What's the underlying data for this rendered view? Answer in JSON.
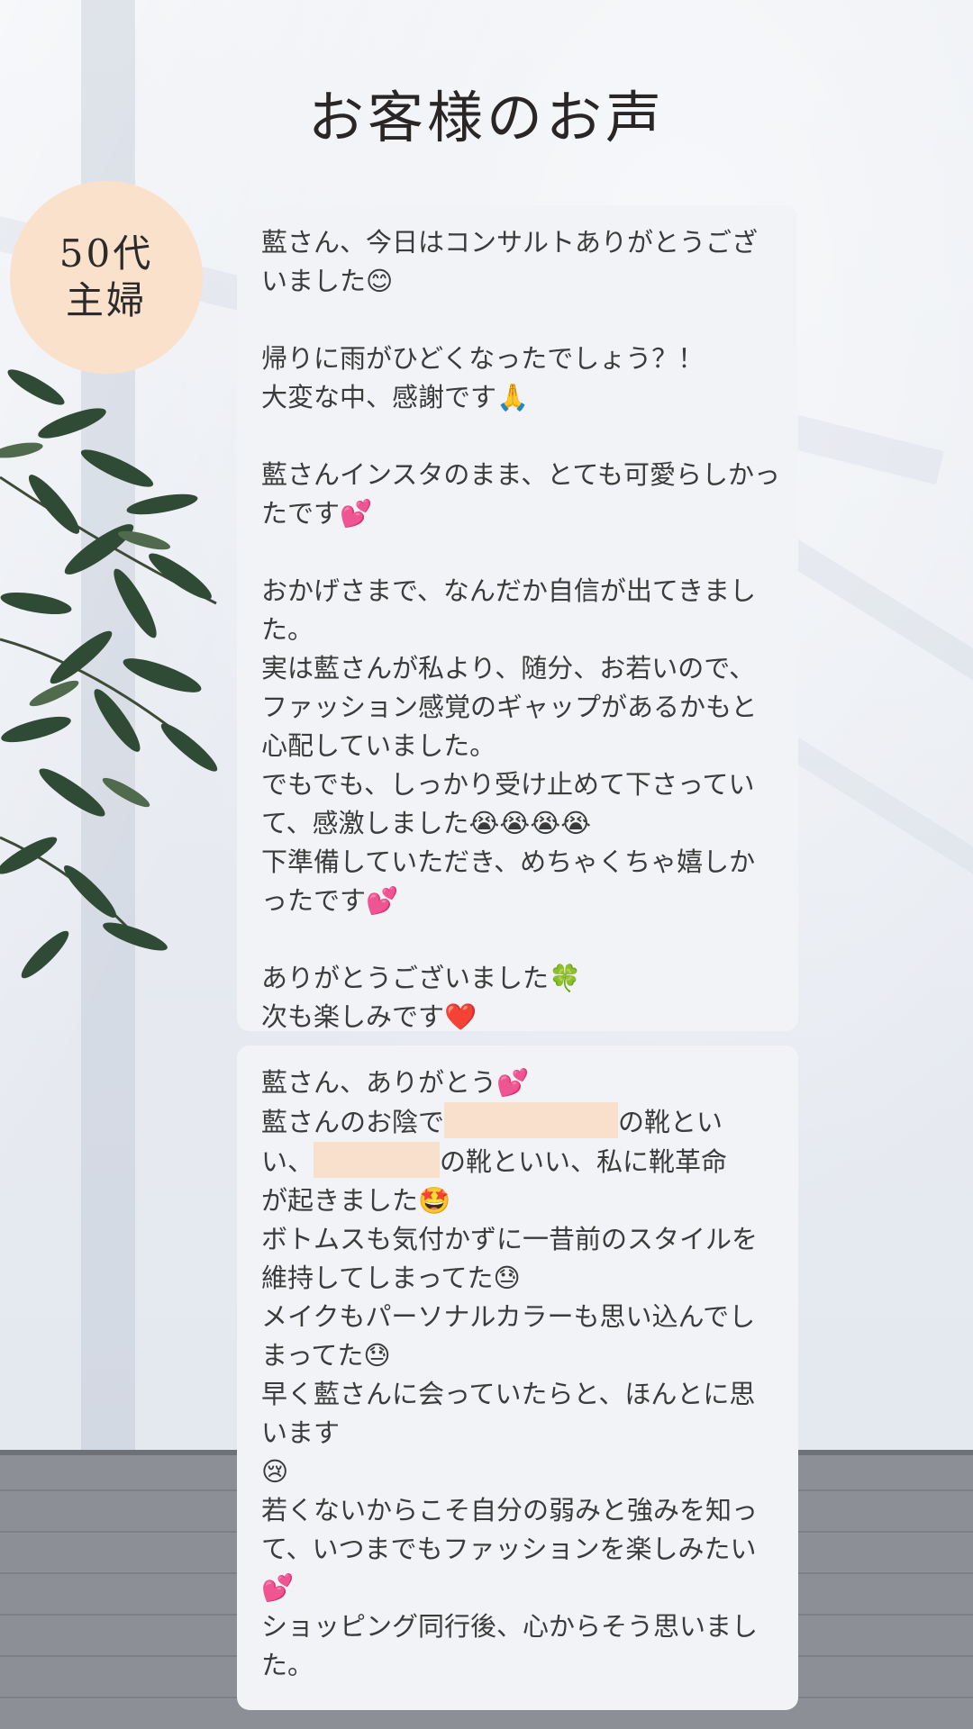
{
  "title": "お客様のお声",
  "badge": {
    "line1": "50代",
    "line2": "主婦"
  },
  "card1": {
    "p1": "藍さん、今日はコンサルトありがとうございました😊",
    "p2a": "帰りに雨がひどくなったでしょう？！",
    "p2b": "大変な中、感謝です🙏",
    "p3": "藍さんインスタのまま、とても可愛らしかったです💕",
    "p4a": "おかげさまで、なんだか自信が出てきました。",
    "p4b": "実は藍さんが私より、随分、お若いので、ファッション感覚のギャップがあるかもと心配していました。",
    "p4c": "でもでも、しっかり受け止めて下さっていて、感激しました😭😭😭😭",
    "p4d": "下準備していただき、めちゃくちゃ嬉しかったです💕",
    "p5a": "ありがとうございました🍀",
    "p5b": "次も楽しみです❤️"
  },
  "card2": {
    "l1": "藍さん、ありがとう💕",
    "l2a": "藍さんのお陰で",
    "l2b": "の靴とい",
    "l3a": "い、",
    "l3b": "の靴といい、私に靴革命",
    "l4": "が起きました🤩",
    "l5": "ボトムスも気付かずに一昔前のスタイルを維持してしまってた😓",
    "l6": "メイクもパーソナルカラーも思い込んでしまってた😓",
    "l7": "早く藍さんに会っていたらと、ほんとに思います",
    "l8": "😢",
    "l9": "若くないからこそ自分の弱みと強みを知って、いつまでもファッションを楽しみたい💕",
    "l10": "ショッピング同行後、心からそう思いました。"
  }
}
